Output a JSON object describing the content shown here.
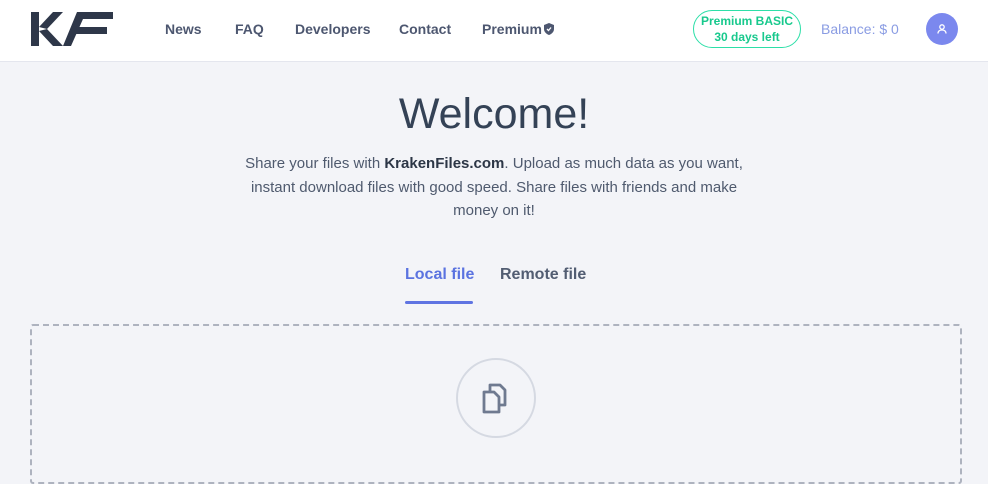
{
  "header": {
    "logo_text": "KF",
    "nav": [
      "News",
      "FAQ",
      "Developers",
      "Contact",
      "Premium"
    ],
    "premium_badge": {
      "plan": "Premium BASIC",
      "remaining": "30 days left"
    },
    "balance": "Balance: $ 0",
    "user_icon": "user-icon"
  },
  "main": {
    "title": "Welcome!",
    "intro": {
      "part1": "Share your files with ",
      "site": "KrakenFiles.com",
      "part2": ". Upload as much data as you want, instant download files with good speed. Share files with friends and make money on it!"
    },
    "tabs": [
      {
        "label": "Local file",
        "active": true
      },
      {
        "label": "Remote file",
        "active": false
      }
    ],
    "upload_icon": "files-copy-icon"
  },
  "colors": {
    "accent": "#5f74e2",
    "premium_green": "#18c98d",
    "balance_blue": "#8a9ce3",
    "text_dark": "#344256",
    "background": "#f3f4f8"
  }
}
